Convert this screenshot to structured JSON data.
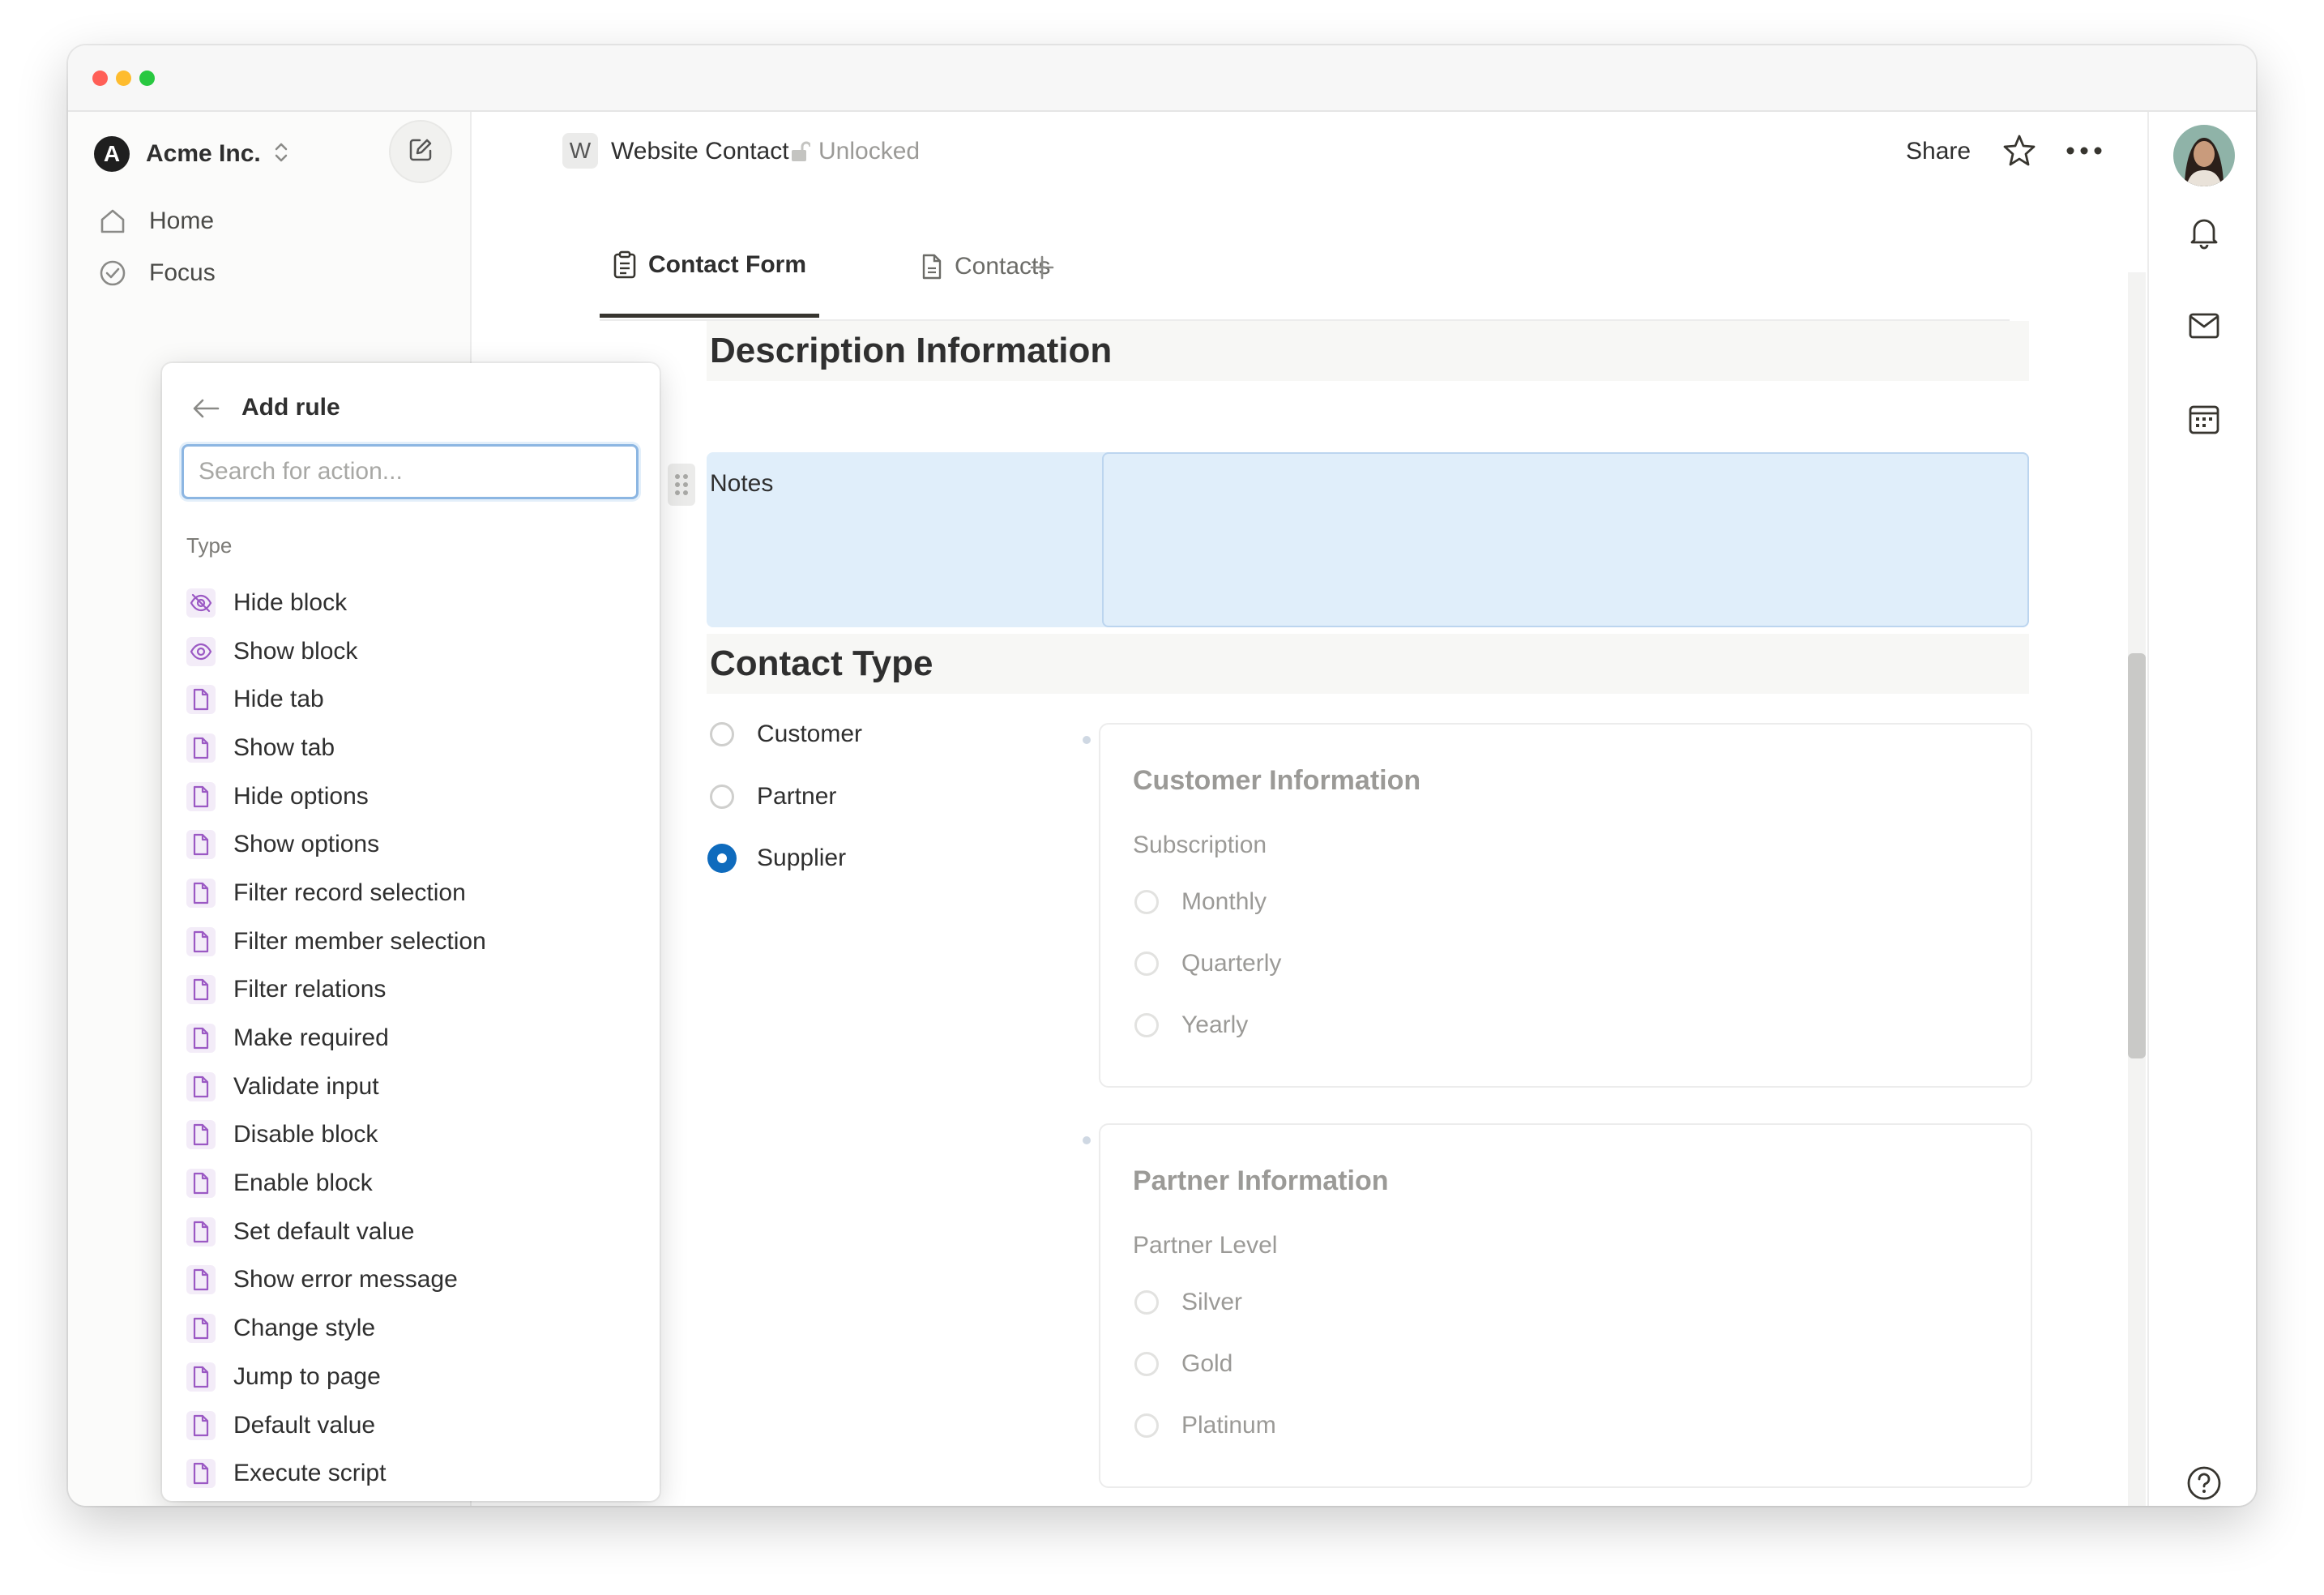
{
  "workspace": {
    "logo_letter": "A",
    "name": "Acme Inc."
  },
  "sidebar": {
    "items": [
      {
        "label": "Home",
        "icon": "home-icon"
      },
      {
        "label": "Focus",
        "icon": "check-circle-icon"
      }
    ]
  },
  "topbar": {
    "page_chip": "W",
    "page_title": "Website Contact",
    "lock_status": "Unlocked",
    "share_label": "Share"
  },
  "tabs": [
    {
      "label": "Contact Form",
      "icon": "clipboard-icon",
      "active": true
    },
    {
      "label": "Contacts",
      "icon": "document-icon",
      "active": false
    }
  ],
  "form": {
    "description_header": "Description Information",
    "notes_label": "Notes",
    "notes_value": "",
    "contact_type_header": "Contact Type",
    "contact_type_options": [
      {
        "label": "Customer",
        "checked": false
      },
      {
        "label": "Partner",
        "checked": false
      },
      {
        "label": "Supplier",
        "checked": true
      }
    ],
    "customer_card": {
      "title": "Customer Information",
      "field_label": "Subscription",
      "options": [
        "Monthly",
        "Quarterly",
        "Yearly"
      ]
    },
    "partner_card": {
      "title": "Partner Information",
      "field_label": "Partner Level",
      "options": [
        "Silver",
        "Gold",
        "Platinum"
      ]
    }
  },
  "add_rule_menu": {
    "title": "Add rule",
    "search_placeholder": "Search for action...",
    "section_label": "Type",
    "items": [
      {
        "label": "Hide block",
        "icon": "eye-off-icon"
      },
      {
        "label": "Show block",
        "icon": "eye-icon"
      },
      {
        "label": "Hide tab",
        "icon": "page-icon"
      },
      {
        "label": "Show tab",
        "icon": "page-icon"
      },
      {
        "label": "Hide options",
        "icon": "page-icon"
      },
      {
        "label": "Show options",
        "icon": "page-icon"
      },
      {
        "label": "Filter record selection",
        "icon": "page-icon"
      },
      {
        "label": "Filter member selection",
        "icon": "page-icon"
      },
      {
        "label": "Filter relations",
        "icon": "page-icon"
      },
      {
        "label": "Make required",
        "icon": "page-icon"
      },
      {
        "label": "Validate input",
        "icon": "page-icon"
      },
      {
        "label": "Disable block",
        "icon": "page-icon"
      },
      {
        "label": "Enable block",
        "icon": "page-icon"
      },
      {
        "label": "Set default value",
        "icon": "page-icon"
      },
      {
        "label": "Show error message",
        "icon": "page-icon"
      },
      {
        "label": "Change style",
        "icon": "page-icon"
      },
      {
        "label": "Jump to page",
        "icon": "page-icon"
      },
      {
        "label": "Default value",
        "icon": "page-icon"
      },
      {
        "label": "Execute script",
        "icon": "page-icon"
      }
    ]
  },
  "colors": {
    "accent": "#0f6bbd",
    "selection_bg": "#e0eefa",
    "menu_icon": "#9b59c4"
  }
}
